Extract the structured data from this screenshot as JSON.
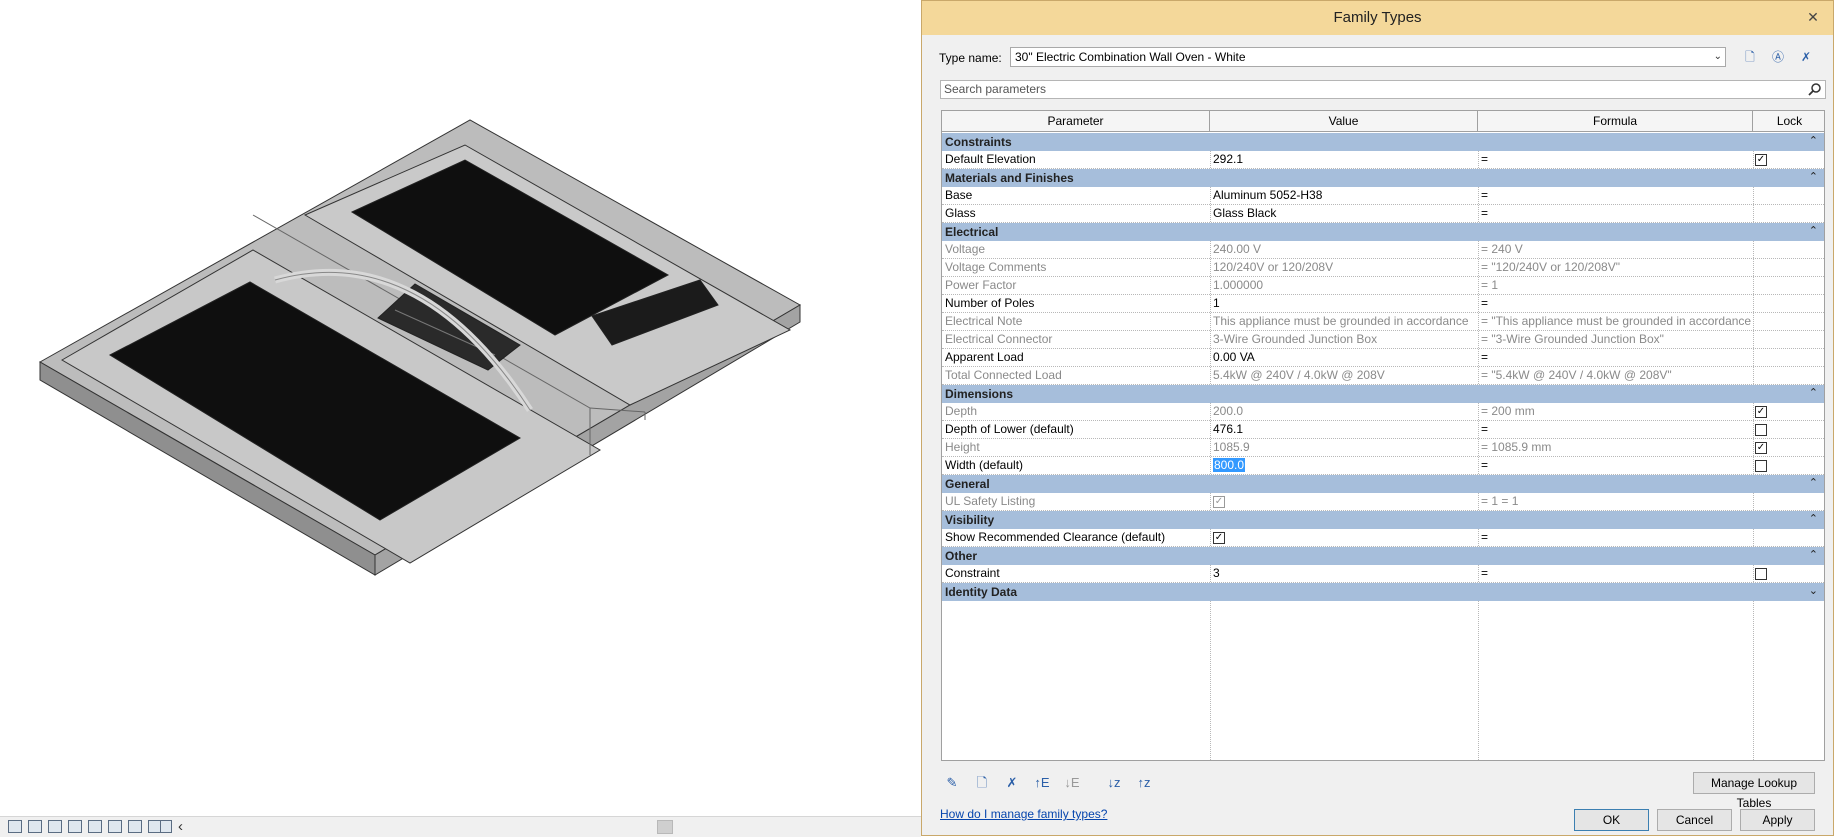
{
  "dialog": {
    "title": "Family Types",
    "close_icon": "close-icon",
    "type_name_label": "Type name:",
    "type_name_value": "30\" Electric Combination Wall Oven - White",
    "toolbar_icons": [
      "new-type-icon",
      "rename-type-icon",
      "delete-type-icon"
    ],
    "search_placeholder": "Search parameters",
    "columns": [
      "Parameter",
      "Value",
      "Formula",
      "Lock"
    ],
    "groups": [
      {
        "name": "Constraints",
        "toggle": "«",
        "rows": [
          {
            "param": "Default Elevation",
            "value": "292.1",
            "formula": "=",
            "lock": "checked",
            "readonly": false
          }
        ]
      },
      {
        "name": "Materials and Finishes",
        "toggle": "«",
        "rows": [
          {
            "param": "Base",
            "value": "Aluminum 5052-H38",
            "formula": "=",
            "lock": "none",
            "readonly": false
          },
          {
            "param": "Glass",
            "value": "Glass Black",
            "formula": "=",
            "lock": "none",
            "readonly": false
          }
        ]
      },
      {
        "name": "Electrical",
        "toggle": "«",
        "rows": [
          {
            "param": "Voltage",
            "value": "240.00 V",
            "formula": "= 240 V",
            "lock": "none",
            "readonly": true
          },
          {
            "param": "Voltage Comments",
            "value": "120/240V or 120/208V",
            "formula": "= \"120/240V or 120/208V\"",
            "lock": "none",
            "readonly": true
          },
          {
            "param": "Power Factor",
            "value": "1.000000",
            "formula": "= 1",
            "lock": "none",
            "readonly": true
          },
          {
            "param": "Number of Poles",
            "value": "1",
            "formula": "=",
            "lock": "none",
            "readonly": false
          },
          {
            "param": "Electrical Note",
            "value": "This appliance must be grounded in accordance",
            "formula": "= \"This appliance must be grounded in accordance",
            "lock": "none",
            "readonly": true
          },
          {
            "param": "Electrical Connector",
            "value": "3-Wire Grounded Junction Box",
            "formula": "= \"3-Wire Grounded Junction Box\"",
            "lock": "none",
            "readonly": true
          },
          {
            "param": "Apparent Load",
            "value": "0.00 VA",
            "formula": "=",
            "lock": "none",
            "readonly": false
          },
          {
            "param": "Total Connected Load",
            "value": "5.4kW @ 240V / 4.0kW @ 208V",
            "formula": "= \"5.4kW @ 240V / 4.0kW @ 208V\"",
            "lock": "none",
            "readonly": true
          }
        ]
      },
      {
        "name": "Dimensions",
        "toggle": "«",
        "rows": [
          {
            "param": "Depth",
            "value": "200.0",
            "formula": "= 200 mm",
            "lock": "checked",
            "readonly": true
          },
          {
            "param": "Depth of Lower (default)",
            "value": "476.1",
            "formula": "=",
            "lock": "unchecked",
            "readonly": false
          },
          {
            "param": "Height",
            "value": "1085.9",
            "formula": "= 1085.9 mm",
            "lock": "checked",
            "readonly": true
          },
          {
            "param": "Width (default)",
            "value": "800.0",
            "formula": "=",
            "lock": "unchecked",
            "readonly": false,
            "selected": true
          }
        ]
      },
      {
        "name": "General",
        "toggle": "«",
        "rows": [
          {
            "param": "UL Safety Listing",
            "value": "",
            "value_checkbox": "checked-dim",
            "formula": "= 1 = 1",
            "lock": "none",
            "readonly": true
          }
        ]
      },
      {
        "name": "Visibility",
        "toggle": "«",
        "rows": [
          {
            "param": "Show Recommended Clearance (default)",
            "value": "",
            "value_checkbox": "checked",
            "formula": "=",
            "lock": "none",
            "readonly": false
          }
        ]
      },
      {
        "name": "Other",
        "toggle": "«",
        "rows": [
          {
            "param": "Constraint",
            "value": "3",
            "formula": "=",
            "lock": "unchecked",
            "readonly": false
          }
        ]
      },
      {
        "name": "Identity Data",
        "toggle": "»",
        "rows": []
      }
    ],
    "bottom_icons": [
      "edit-parameter-icon",
      "new-parameter-icon",
      "delete-parameter-icon",
      "move-up-icon",
      "move-down-icon",
      "sort-ascending-icon",
      "sort-descending-icon"
    ],
    "manage_lookup_label": "Manage Lookup Tables",
    "help_link": "How do I manage family types?",
    "ok_label": "OK",
    "cancel_label": "Cancel",
    "apply_label": "Apply"
  },
  "statusbar": {
    "icons": [
      "view-scale-icon",
      "detail-level-icon",
      "visual-style-icon",
      "sun-path-icon",
      "shadows-icon",
      "render-icon",
      "crop-icon",
      "show-crop-icon",
      "temp-hide-icon"
    ],
    "arrow": "‹"
  },
  "colors": {
    "titlebar": "#f4d89a",
    "group_header": "#a6bedb",
    "link": "#0645ad",
    "selection": "#3399ff"
  }
}
